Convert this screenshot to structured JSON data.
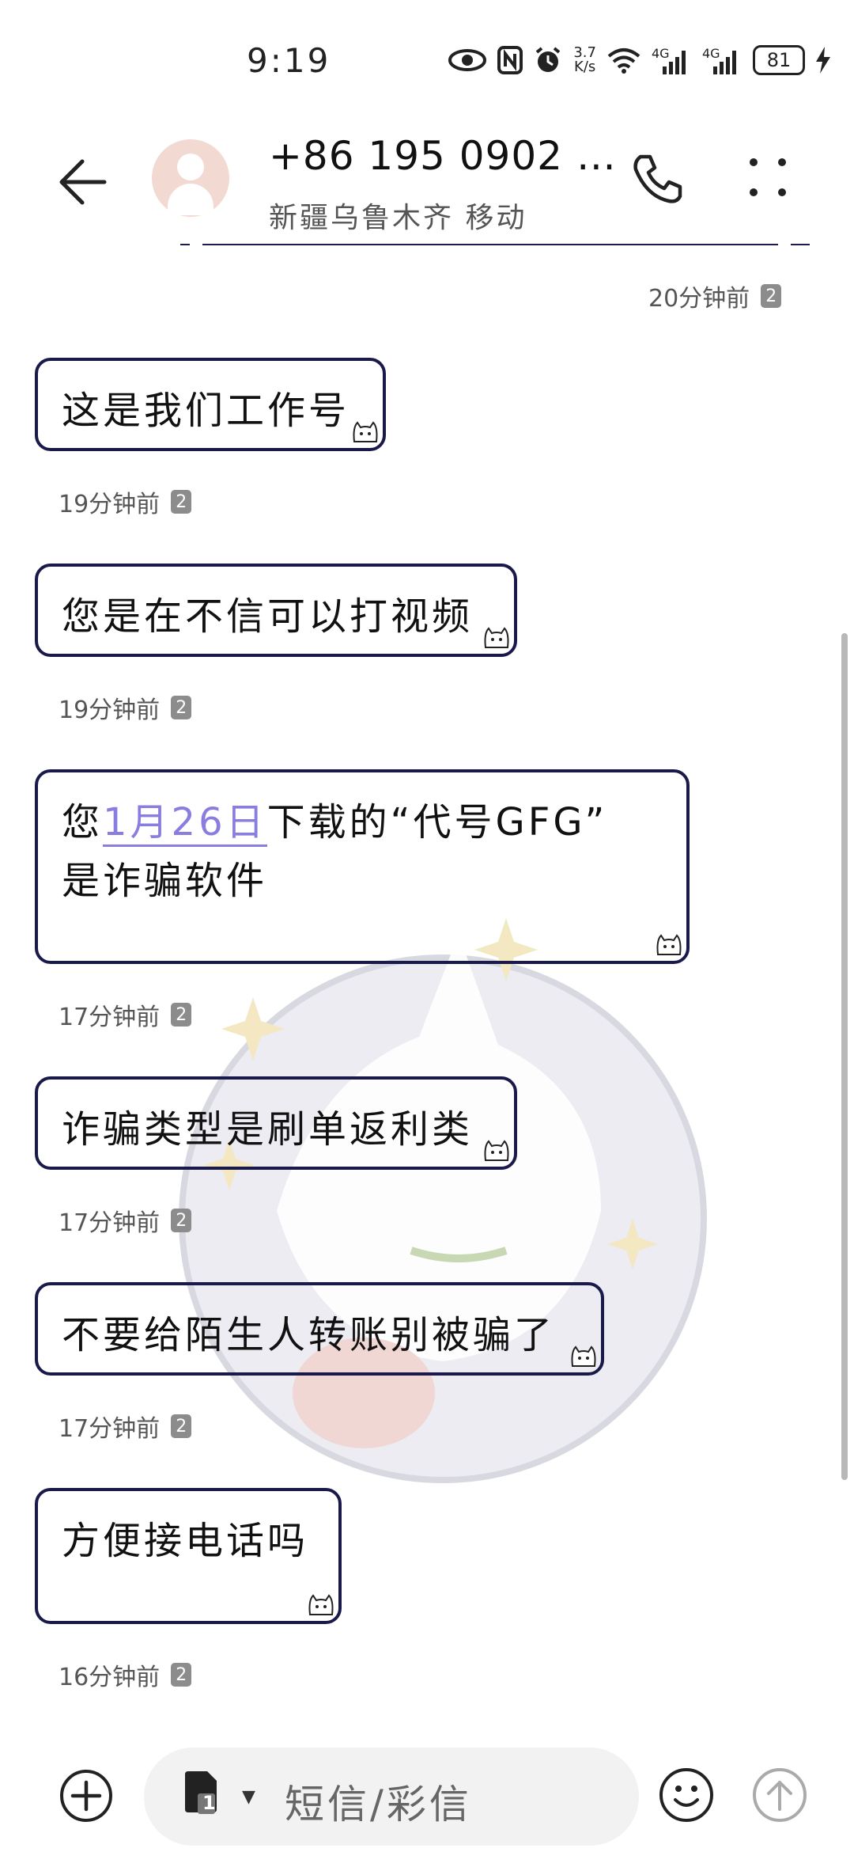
{
  "status_bar": {
    "time": "9:19",
    "speed_value": "3.7",
    "speed_unit": "K/s",
    "net1": "4G",
    "net2": "4G",
    "battery": "81"
  },
  "header": {
    "contact_name": "+86 195 0902 …",
    "contact_location": "新疆乌鲁木齐 移动"
  },
  "messages": [
    {
      "pre": "这是我们工作号",
      "link": "",
      "post": "",
      "line2": "",
      "time": "19分钟前",
      "sim": "2"
    },
    {
      "pre": "您是在不信可以打视频",
      "link": "",
      "post": "",
      "line2": "",
      "time": "19分钟前",
      "sim": "2"
    },
    {
      "pre": "您",
      "link": "1月26日",
      "post": "下载的“代号GFG”",
      "line2": "是诈骗软件",
      "time": "17分钟前",
      "sim": "2"
    },
    {
      "pre": "诈骗类型是刷单返利类",
      "link": "",
      "post": "",
      "line2": "",
      "time": "17分钟前",
      "sim": "2"
    },
    {
      "pre": "不要给陌生人转账别被骗了",
      "link": "",
      "post": "",
      "line2": "",
      "time": "17分钟前",
      "sim": "2"
    },
    {
      "pre": "方便接电话吗",
      "link": "",
      "post": "",
      "line2": "",
      "time": "16分钟前",
      "sim": "2"
    }
  ],
  "top_meta": {
    "time": "20分钟前",
    "sim": "2"
  },
  "input": {
    "sim_number": "1",
    "placeholder": "短信/彩信"
  },
  "colors": {
    "bubble_border": "#1a1a4a",
    "link": "#8a7de0",
    "avatar_bg": "#f2d9d2"
  }
}
